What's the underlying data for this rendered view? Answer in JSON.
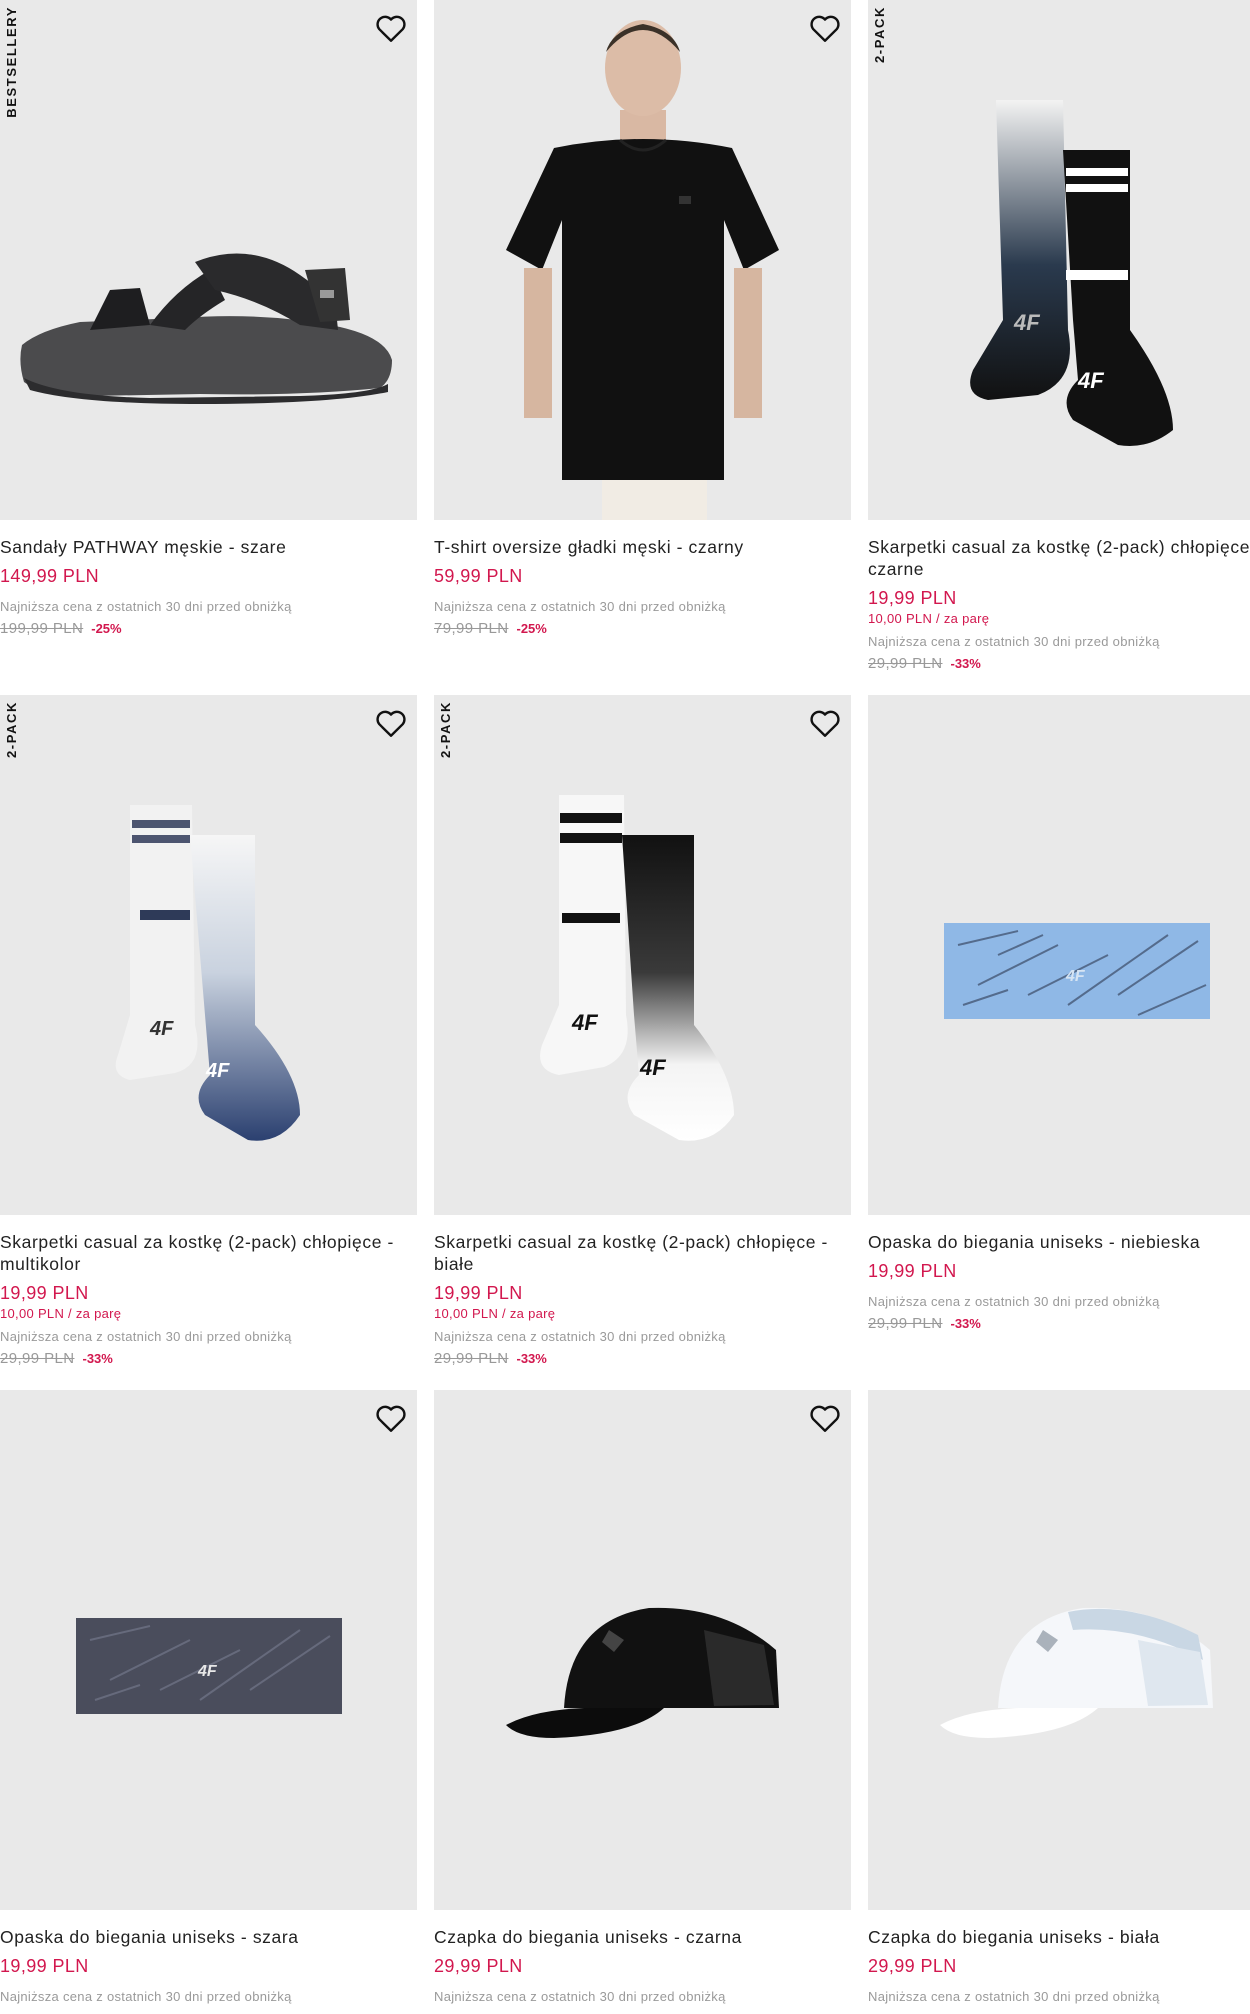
{
  "products": [
    {
      "badge": "BESTSELLERY",
      "name": "Sandały PATHWAY męskie - szare",
      "price": "149,99 PLN",
      "lowest": "Najniższa cena z ostatnich 30 dni przed obniżką",
      "old_price": "199,99 PLN",
      "discount": "-25%",
      "image": "sandal-grey"
    },
    {
      "name": "T-shirt oversize gładki męski - czarny",
      "price": "59,99 PLN",
      "lowest": "Najniższa cena z ostatnich 30 dni przed obniżką",
      "old_price": "79,99 PLN",
      "discount": "-25%",
      "image": "tshirt-black"
    },
    {
      "badge": "2-PACK",
      "name": "Skarpetki casual za kostkę (2-pack) chłopięce - czarne",
      "price": "19,99 PLN",
      "unit_price": "10,00 PLN / za parę",
      "lowest": "Najniższa cena z ostatnich 30 dni przed obniżką",
      "old_price": "29,99 PLN",
      "discount": "-33%",
      "image": "socks-black"
    },
    {
      "badge": "2-PACK",
      "name": "Skarpetki casual za kostkę (2-pack) chłopięce - multikolor",
      "price": "19,99 PLN",
      "unit_price": "10,00 PLN / za parę",
      "lowest": "Najniższa cena z ostatnich 30 dni przed obniżką",
      "old_price": "29,99 PLN",
      "discount": "-33%",
      "image": "socks-navy"
    },
    {
      "badge": "2-PACK",
      "name": "Skarpetki casual za kostkę (2-pack) chłopięce - białe",
      "price": "19,99 PLN",
      "unit_price": "10,00 PLN / za parę",
      "lowest": "Najniższa cena z ostatnich 30 dni przed obniżką",
      "old_price": "29,99 PLN",
      "discount": "-33%",
      "image": "socks-white"
    },
    {
      "name": "Opaska do biegania uniseks - niebieska",
      "price": "19,99 PLN",
      "lowest": "Najniższa cena z ostatnich 30 dni przed obniżką",
      "old_price": "29,99 PLN",
      "discount": "-33%",
      "image": "headband-blue"
    },
    {
      "name": "Opaska do biegania uniseks - szara",
      "price": "19,99 PLN",
      "lowest": "Najniższa cena z ostatnich 30 dni przed obniżką",
      "image": "headband-grey"
    },
    {
      "name": "Czapka do biegania uniseks - czarna",
      "price": "29,99 PLN",
      "lowest": "Najniższa cena z ostatnich 30 dni przed obniżką",
      "image": "cap-black"
    },
    {
      "name": "Czapka do biegania uniseks - biała",
      "price": "29,99 PLN",
      "lowest": "Najniższa cena z ostatnich 30 dni przed obniżką",
      "image": "cap-white"
    }
  ],
  "icons": {
    "favorite": "heart-outline-icon"
  },
  "colors": {
    "price": "#d2174e",
    "image_bg": "#e9e9e9",
    "muted": "#9a9a9a"
  }
}
